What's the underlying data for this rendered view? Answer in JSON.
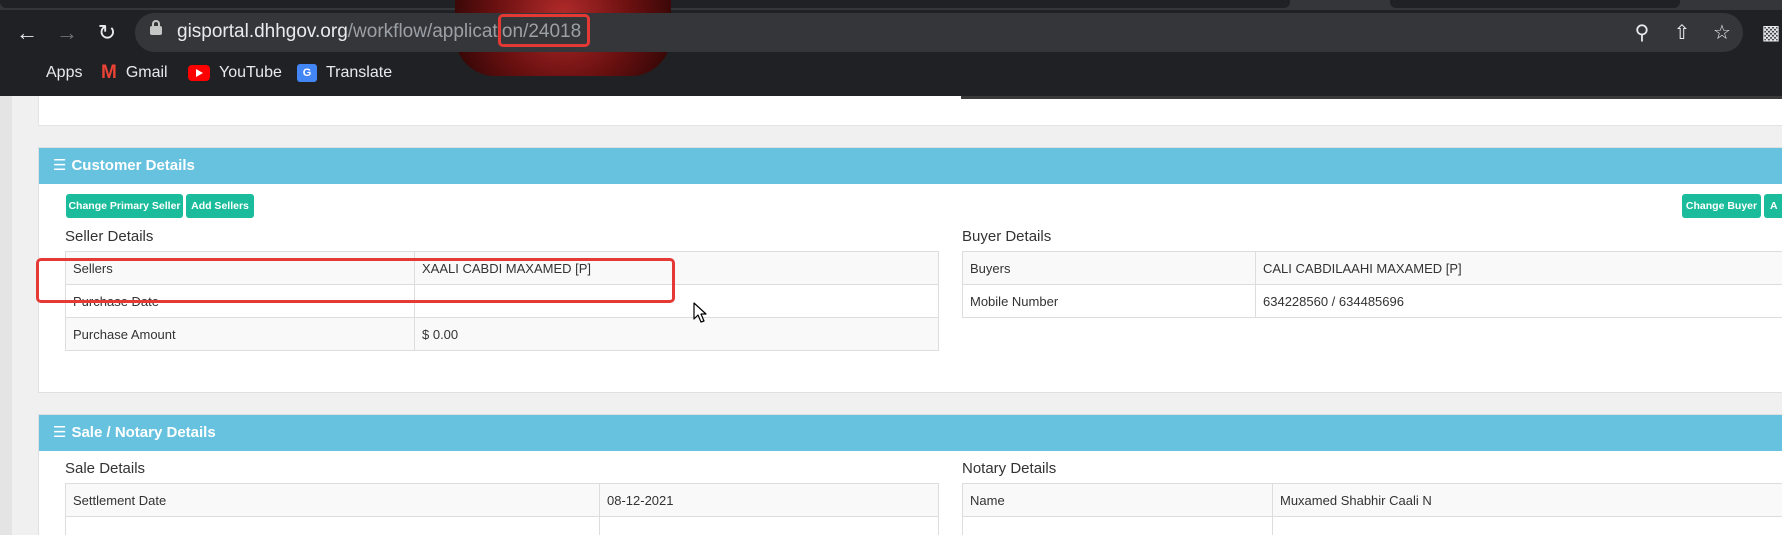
{
  "browser": {
    "url_host": "gisportal.dhhgov.org",
    "url_path": "/workflow/application/24018",
    "icons": {
      "back": "back-arrow-icon",
      "forward": "forward-arrow-icon",
      "reload": "reload-icon",
      "lock": "lock-icon",
      "zoom": "zoom-icon",
      "share": "share-icon",
      "bookmark_star": "star-icon",
      "extensions": "puzzle-icon"
    },
    "bookmarks": [
      {
        "label": "Apps",
        "icon": "apps-grid-icon"
      },
      {
        "label": "Gmail",
        "icon": "gmail-icon"
      },
      {
        "label": "YouTube",
        "icon": "youtube-icon"
      },
      {
        "label": "Translate",
        "icon": "translate-icon"
      }
    ]
  },
  "customer_details": {
    "heading": "Customer Details",
    "buttons": {
      "change_primary_seller": "Change Primary Seller",
      "add_sellers": "Add Sellers",
      "change_buyer": "Change Buyer",
      "add_buyers_partial": "A"
    },
    "seller": {
      "title": "Seller Details",
      "rows": [
        {
          "label": "Sellers",
          "value": "XAALI CABDI MAXAMED [P]"
        },
        {
          "label": "Purchase Date",
          "value": ""
        },
        {
          "label": "Purchase Amount",
          "value": "$ 0.00"
        }
      ]
    },
    "buyer": {
      "title": "Buyer Details",
      "rows": [
        {
          "label": "Buyers",
          "value": "CALI CABDILAAHI MAXAMED [P]"
        },
        {
          "label": "Mobile Number",
          "value": "634228560 / 634485696"
        }
      ]
    }
  },
  "sale_notary": {
    "heading": "Sale / Notary Details",
    "sale": {
      "title": "Sale Details",
      "rows": [
        {
          "label": "Settlement Date",
          "value": "08-12-2021"
        }
      ]
    },
    "notary": {
      "title": "Notary Details",
      "rows": [
        {
          "label": "Name",
          "value": "Muxamed Shabhir Caali N"
        }
      ]
    }
  },
  "colors": {
    "panel_heading": "#67c2df",
    "button": "#1bbc9b",
    "highlight": "#e53935",
    "chrome_bg": "#202124"
  }
}
